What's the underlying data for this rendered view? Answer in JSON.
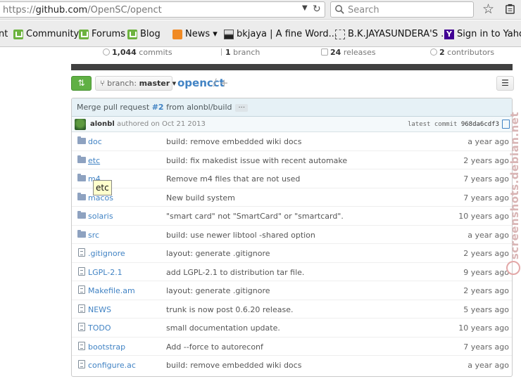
{
  "browser": {
    "url_scheme": "https://",
    "url_host": "github.com",
    "url_path": "/OpenSC/openct",
    "search_placeholder": "Search"
  },
  "bookmarks": [
    {
      "label": "nt",
      "icon": "none"
    },
    {
      "label": "Community",
      "icon": "mint-icon"
    },
    {
      "label": "Forums",
      "icon": "mint-icon"
    },
    {
      "label": "Blog",
      "icon": "mint-icon"
    },
    {
      "label": "News ▾",
      "icon": "rss-icon"
    },
    {
      "label": "bkjaya | A fine Word...",
      "icon": "photo-icon"
    },
    {
      "label": "B.K.JAYASUNDERA'S ...",
      "icon": "blank-page-icon"
    },
    {
      "label": "Sign in to Yahoo",
      "icon": "yahoo-icon"
    }
  ],
  "stats": {
    "commits_count": "1,044",
    "commits_label": "commits",
    "branch_count": "1",
    "branch_label": "branch",
    "releases_count": "24",
    "releases_label": "releases",
    "contributors_count": "2",
    "contributors_label": "contributors"
  },
  "repo": {
    "branch_prefix": "branch:",
    "branch_name": "master",
    "name": "opencct",
    "sep": "/",
    "plus": "+"
  },
  "commit": {
    "message_prefix": "Merge pull request",
    "pr_number": "#2",
    "message_suffix": "from alonbl/build",
    "ellipsis": "···",
    "author": "alonbl",
    "authored": "authored on Oct 21 2013",
    "latest_label": "latest commit",
    "sha": "968da6cdf3"
  },
  "files": [
    {
      "name": "doc",
      "type": "folder",
      "message": "build: remove embedded wiki docs",
      "age": "a year ago"
    },
    {
      "name": "etc",
      "type": "folder",
      "message": "build: fix makedist issue with recent automake",
      "age": "2 years ago"
    },
    {
      "name": "m4",
      "type": "folder",
      "message": "Remove m4 files that are not used",
      "age": "7 years ago"
    },
    {
      "name": "macos",
      "type": "folder",
      "message": "New build system",
      "age": "7 years ago"
    },
    {
      "name": "solaris",
      "type": "folder",
      "message": "\"smart card\" not \"SmartCard\" or \"smartcard\".",
      "age": "10 years ago"
    },
    {
      "name": "src",
      "type": "folder",
      "message": "build: use newer libtool -shared option",
      "age": "a year ago"
    },
    {
      "name": ".gitignore",
      "type": "file",
      "message": "layout: generate .gitignore",
      "age": "2 years ago"
    },
    {
      "name": "LGPL-2.1",
      "type": "file",
      "message": "add LGPL-2.1 to distribution tar file.",
      "age": "9 years ago"
    },
    {
      "name": "Makefile.am",
      "type": "file",
      "message": "layout: generate .gitignore",
      "age": "2 years ago"
    },
    {
      "name": "NEWS",
      "type": "file",
      "message": "trunk is now post 0.6.20 release.",
      "age": "5 years ago"
    },
    {
      "name": "TODO",
      "type": "file",
      "message": "small documentation update.",
      "age": "10 years ago"
    },
    {
      "name": "bootstrap",
      "type": "file",
      "message": "Add --force to autoreconf",
      "age": "7 years ago"
    },
    {
      "name": "configure.ac",
      "type": "file",
      "message": "build: remove embedded wiki docs",
      "age": "a year ago"
    }
  ],
  "tooltip": "etc",
  "watermark": "screenshots.debian.net",
  "colors": {
    "link": "#4183c4",
    "compare_green": "#60b044",
    "commit_bar": "#e6f1f6"
  }
}
